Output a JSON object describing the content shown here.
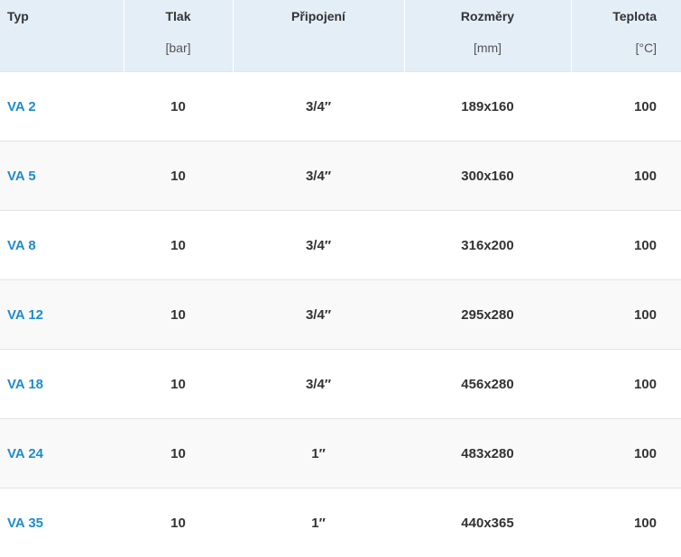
{
  "table": {
    "columns": [
      {
        "title": "Typ",
        "unit": ""
      },
      {
        "title": "Tlak",
        "unit": "[bar]"
      },
      {
        "title": "Připojení",
        "unit": ""
      },
      {
        "title": "Rozměry",
        "unit": "[mm]"
      },
      {
        "title": "Teplota",
        "unit": "[°C]"
      }
    ],
    "rows": [
      {
        "typ": "VA 2",
        "tlak": "10",
        "pripojeni": "3/4″",
        "rozmery": "189x160",
        "teplota": "100"
      },
      {
        "typ": "VA 5",
        "tlak": "10",
        "pripojeni": "3/4″",
        "rozmery": "300x160",
        "teplota": "100"
      },
      {
        "typ": "VA 8",
        "tlak": "10",
        "pripojeni": "3/4″",
        "rozmery": "316x200",
        "teplota": "100"
      },
      {
        "typ": "VA 12",
        "tlak": "10",
        "pripojeni": "3/4″",
        "rozmery": "295x280",
        "teplota": "100"
      },
      {
        "typ": "VA 18",
        "tlak": "10",
        "pripojeni": "3/4″",
        "rozmery": "456x280",
        "teplota": "100"
      },
      {
        "typ": "VA 24",
        "tlak": "10",
        "pripojeni": "1″",
        "rozmery": "483x280",
        "teplota": "100"
      },
      {
        "typ": "VA 35",
        "tlak": "10",
        "pripojeni": "1″",
        "rozmery": "440x365",
        "teplota": "100"
      }
    ]
  },
  "colors": {
    "header_bg": "#e3eef6",
    "link": "#1e8ccc",
    "text": "#333333",
    "row_alt_bg": "#f9f9f9"
  }
}
